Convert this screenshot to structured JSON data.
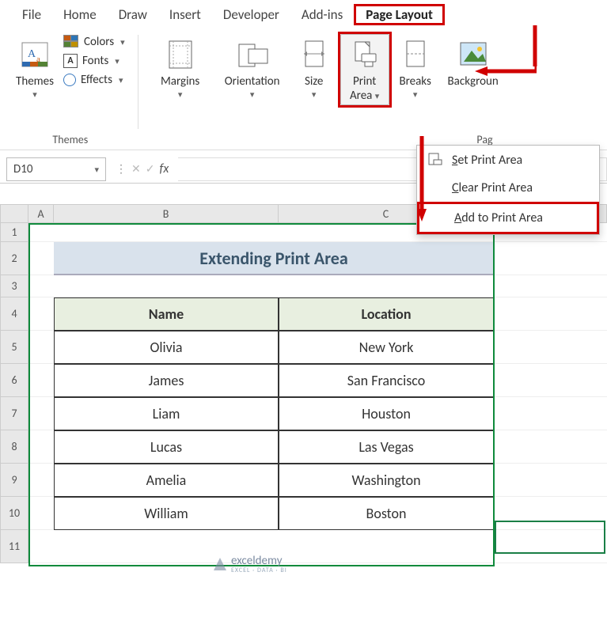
{
  "menu": {
    "tabs": [
      "File",
      "Home",
      "Draw",
      "Insert",
      "Developer",
      "Add-ins",
      "Page Layout"
    ],
    "active": "Page Layout"
  },
  "ribbon": {
    "themes_group_label": "Themes",
    "themes_btn": "Themes",
    "colors": "Colors",
    "fonts": "Fonts",
    "effects": "Effects",
    "page_setup_group_label": "Pag",
    "margins": "Margins",
    "orientation": "Orientation",
    "size": "Size",
    "print_area_line1": "Print",
    "print_area_line2": "Area",
    "breaks": "Breaks",
    "background": "Backgroun"
  },
  "dropdown": {
    "set": "et Print Area",
    "set_prefix": "S",
    "clear": "lear Print Area",
    "clear_prefix": "C",
    "add": "dd to Print Area",
    "add_prefix": "A"
  },
  "formula_bar": {
    "name_box": "D10",
    "fx": "fx",
    "value": ""
  },
  "columns": [
    "A",
    "B",
    "C"
  ],
  "sheet": {
    "title": "Extending Print Area",
    "headers": {
      "name": "Name",
      "location": "Location"
    },
    "rows": [
      {
        "name": "Olivia",
        "location": "New York"
      },
      {
        "name": "James",
        "location": "San Francisco"
      },
      {
        "name": "Liam",
        "location": "Houston"
      },
      {
        "name": "Lucas",
        "location": "Las Vegas"
      },
      {
        "name": "Amelia",
        "location": "Washington"
      },
      {
        "name": "William",
        "location": "Boston"
      }
    ]
  },
  "watermark": {
    "text": "exceldemy",
    "sub": "EXCEL · DATA · BI"
  }
}
